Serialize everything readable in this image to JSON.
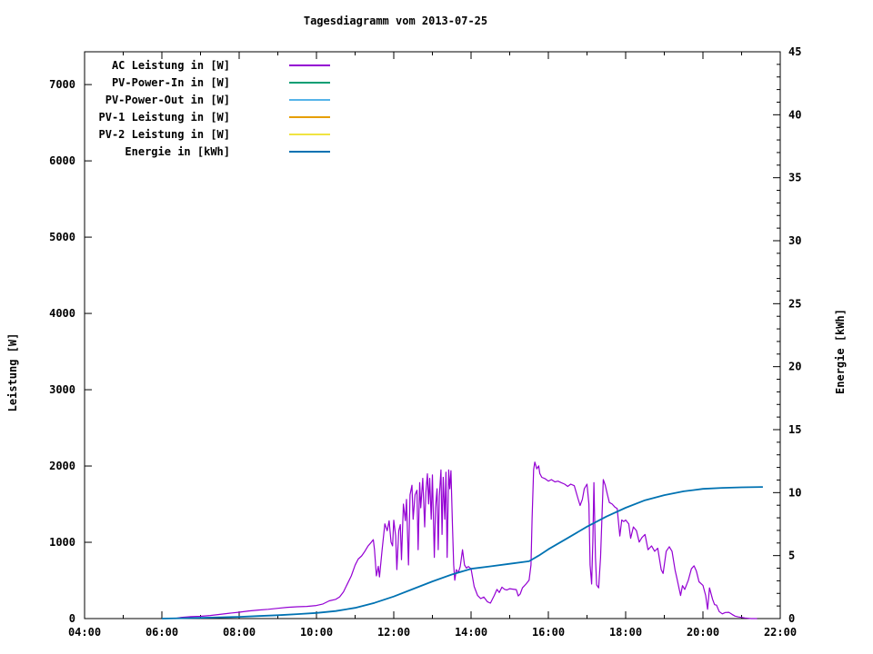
{
  "chart_data": {
    "type": "line",
    "title": "Tagesdiagramm vom 2013-07-25",
    "axes": {
      "x": {
        "tick_labels": [
          "04:00",
          "06:00",
          "08:00",
          "10:00",
          "12:00",
          "14:00",
          "16:00",
          "18:00",
          "20:00",
          "22:00"
        ],
        "tick_hours": [
          4,
          6,
          8,
          10,
          12,
          14,
          16,
          18,
          20,
          22
        ],
        "minor_step_hours": 1,
        "range_hours": [
          4,
          22
        ]
      },
      "y_left": {
        "label": "Leistung [W]",
        "tick_values": [
          0,
          1000,
          2000,
          3000,
          4000,
          5000,
          6000,
          7000
        ],
        "range": [
          0,
          7430
        ]
      },
      "y_right": {
        "label": "Energie [kWh]",
        "tick_values": [
          0,
          5,
          10,
          15,
          20,
          25,
          30,
          35,
          40,
          45
        ],
        "minor_step": 1,
        "range": [
          0,
          45
        ]
      }
    },
    "legend_position": "top-left",
    "grid": false,
    "series": [
      {
        "name": "AC Leistung in [W]",
        "color": "#9400d3",
        "axis": "left",
        "points": [
          [
            6.33,
            0
          ],
          [
            6.5,
            15
          ],
          [
            6.75,
            25
          ],
          [
            7.0,
            30
          ],
          [
            7.25,
            40
          ],
          [
            7.5,
            55
          ],
          [
            7.75,
            70
          ],
          [
            8.0,
            83
          ],
          [
            8.25,
            100
          ],
          [
            8.5,
            112
          ],
          [
            8.75,
            122
          ],
          [
            9.0,
            135
          ],
          [
            9.25,
            148
          ],
          [
            9.5,
            155
          ],
          [
            9.75,
            160
          ],
          [
            10.0,
            172
          ],
          [
            10.17,
            192
          ],
          [
            10.33,
            232
          ],
          [
            10.5,
            252
          ],
          [
            10.6,
            285
          ],
          [
            10.7,
            350
          ],
          [
            10.8,
            455
          ],
          [
            10.9,
            560
          ],
          [
            11.0,
            700
          ],
          [
            11.08,
            780
          ],
          [
            11.17,
            822
          ],
          [
            11.25,
            880
          ],
          [
            11.33,
            948
          ],
          [
            11.42,
            1002
          ],
          [
            11.47,
            1035
          ],
          [
            11.5,
            905
          ],
          [
            11.55,
            560
          ],
          [
            11.6,
            685
          ],
          [
            11.63,
            545
          ],
          [
            11.7,
            902
          ],
          [
            11.77,
            1242
          ],
          [
            11.83,
            1152
          ],
          [
            11.88,
            1282
          ],
          [
            11.93,
            1002
          ],
          [
            11.97,
            952
          ],
          [
            12.0,
            1290
          ],
          [
            12.05,
            1082
          ],
          [
            12.08,
            642
          ],
          [
            12.13,
            1152
          ],
          [
            12.17,
            1232
          ],
          [
            12.2,
            772
          ],
          [
            12.25,
            1500
          ],
          [
            12.3,
            1282
          ],
          [
            12.33,
            1562
          ],
          [
            12.38,
            702
          ],
          [
            12.42,
            1622
          ],
          [
            12.47,
            1748
          ],
          [
            12.5,
            1302
          ],
          [
            12.55,
            1622
          ],
          [
            12.6,
            1682
          ],
          [
            12.63,
            902
          ],
          [
            12.67,
            1782
          ],
          [
            12.7,
            1452
          ],
          [
            12.75,
            1838
          ],
          [
            12.8,
            1202
          ],
          [
            12.83,
            1652
          ],
          [
            12.87,
            1898
          ],
          [
            12.9,
            1502
          ],
          [
            12.93,
            1838
          ],
          [
            12.97,
            1302
          ],
          [
            13.0,
            1882
          ],
          [
            13.05,
            802
          ],
          [
            13.08,
            1452
          ],
          [
            13.12,
            1702
          ],
          [
            13.15,
            902
          ],
          [
            13.18,
            1602
          ],
          [
            13.22,
            1948
          ],
          [
            13.25,
            1102
          ],
          [
            13.28,
            1852
          ],
          [
            13.32,
            1302
          ],
          [
            13.35,
            1918
          ],
          [
            13.38,
            802
          ],
          [
            13.42,
            1948
          ],
          [
            13.45,
            1702
          ],
          [
            13.48,
            1938
          ],
          [
            13.52,
            1202
          ],
          [
            13.55,
            702
          ],
          [
            13.58,
            502
          ],
          [
            13.62,
            642
          ],
          [
            13.67,
            602
          ],
          [
            13.72,
            682
          ],
          [
            13.78,
            902
          ],
          [
            13.83,
            702
          ],
          [
            13.88,
            662
          ],
          [
            13.93,
            682
          ],
          [
            14.0,
            652
          ],
          [
            14.08,
            422
          ],
          [
            14.17,
            302
          ],
          [
            14.25,
            262
          ],
          [
            14.33,
            282
          ],
          [
            14.42,
            222
          ],
          [
            14.5,
            202
          ],
          [
            14.6,
            302
          ],
          [
            14.67,
            382
          ],
          [
            14.73,
            342
          ],
          [
            14.8,
            412
          ],
          [
            14.87,
            382
          ],
          [
            14.93,
            375
          ],
          [
            15.0,
            392
          ],
          [
            15.08,
            386
          ],
          [
            15.17,
            380
          ],
          [
            15.22,
            296
          ],
          [
            15.27,
            322
          ],
          [
            15.33,
            402
          ],
          [
            15.42,
            452
          ],
          [
            15.5,
            502
          ],
          [
            15.55,
            702
          ],
          [
            15.58,
            1302
          ],
          [
            15.62,
            1952
          ],
          [
            15.65,
            2052
          ],
          [
            15.7,
            1962
          ],
          [
            15.75,
            2002
          ],
          [
            15.78,
            1902
          ],
          [
            15.83,
            1852
          ],
          [
            15.92,
            1832
          ],
          [
            16.0,
            1802
          ],
          [
            16.08,
            1822
          ],
          [
            16.17,
            1792
          ],
          [
            16.25,
            1802
          ],
          [
            16.33,
            1782
          ],
          [
            16.42,
            1762
          ],
          [
            16.5,
            1732
          ],
          [
            16.58,
            1762
          ],
          [
            16.67,
            1742
          ],
          [
            16.75,
            1602
          ],
          [
            16.82,
            1482
          ],
          [
            16.88,
            1562
          ],
          [
            16.93,
            1702
          ],
          [
            17.0,
            1762
          ],
          [
            17.05,
            1502
          ],
          [
            17.08,
            702
          ],
          [
            17.12,
            452
          ],
          [
            17.15,
            1002
          ],
          [
            17.18,
            1782
          ],
          [
            17.22,
            802
          ],
          [
            17.25,
            442
          ],
          [
            17.3,
            402
          ],
          [
            17.35,
            802
          ],
          [
            17.42,
            1822
          ],
          [
            17.47,
            1752
          ],
          [
            17.53,
            1622
          ],
          [
            17.58,
            1522
          ],
          [
            17.65,
            1502
          ],
          [
            17.72,
            1462
          ],
          [
            17.78,
            1442
          ],
          [
            17.85,
            1082
          ],
          [
            17.9,
            1292
          ],
          [
            17.95,
            1272
          ],
          [
            18.0,
            1292
          ],
          [
            18.08,
            1242
          ],
          [
            18.13,
            1052
          ],
          [
            18.2,
            1202
          ],
          [
            18.28,
            1152
          ],
          [
            18.35,
            1002
          ],
          [
            18.42,
            1062
          ],
          [
            18.5,
            1102
          ],
          [
            18.58,
            902
          ],
          [
            18.67,
            952
          ],
          [
            18.75,
            882
          ],
          [
            18.83,
            922
          ],
          [
            18.92,
            642
          ],
          [
            18.97,
            592
          ],
          [
            19.05,
            882
          ],
          [
            19.13,
            942
          ],
          [
            19.2,
            882
          ],
          [
            19.28,
            632
          ],
          [
            19.33,
            522
          ],
          [
            19.42,
            302
          ],
          [
            19.47,
            432
          ],
          [
            19.53,
            382
          ],
          [
            19.62,
            502
          ],
          [
            19.7,
            652
          ],
          [
            19.77,
            692
          ],
          [
            19.83,
            622
          ],
          [
            19.9,
            482
          ],
          [
            20.0,
            436
          ],
          [
            20.07,
            302
          ],
          [
            20.12,
            122
          ],
          [
            20.17,
            402
          ],
          [
            20.25,
            252
          ],
          [
            20.3,
            182
          ],
          [
            20.35,
            176
          ],
          [
            20.42,
            92
          ],
          [
            20.5,
            62
          ],
          [
            20.58,
            80
          ],
          [
            20.67,
            82
          ],
          [
            20.75,
            56
          ],
          [
            20.83,
            32
          ],
          [
            20.92,
            22
          ],
          [
            21.0,
            16
          ],
          [
            21.08,
            8
          ],
          [
            21.17,
            4
          ],
          [
            21.25,
            0
          ],
          [
            21.4,
            0
          ]
        ]
      },
      {
        "name": "PV-Power-In in [W]",
        "color": "#009e73",
        "axis": "left",
        "points": []
      },
      {
        "name": "PV-Power-Out in [W]",
        "color": "#56b4e9",
        "axis": "left",
        "points": []
      },
      {
        "name": "PV-1 Leistung in [W]",
        "color": "#e69f00",
        "axis": "left",
        "points": []
      },
      {
        "name": "PV-2 Leistung in [W]",
        "color": "#f0e442",
        "axis": "left",
        "points": []
      },
      {
        "name": "Energie in [kWh]",
        "color": "#0072b2",
        "axis": "right",
        "points": [
          [
            6.0,
            0
          ],
          [
            6.5,
            0.03
          ],
          [
            7.0,
            0.06
          ],
          [
            7.5,
            0.1
          ],
          [
            8.0,
            0.14
          ],
          [
            8.5,
            0.2
          ],
          [
            9.0,
            0.27
          ],
          [
            9.5,
            0.35
          ],
          [
            10.0,
            0.45
          ],
          [
            10.5,
            0.6
          ],
          [
            11.0,
            0.85
          ],
          [
            11.5,
            1.25
          ],
          [
            12.0,
            1.75
          ],
          [
            12.5,
            2.35
          ],
          [
            13.0,
            2.95
          ],
          [
            13.5,
            3.5
          ],
          [
            14.0,
            3.95
          ],
          [
            14.5,
            4.15
          ],
          [
            15.0,
            4.35
          ],
          [
            15.5,
            4.55
          ],
          [
            15.75,
            5.0
          ],
          [
            16.0,
            5.5
          ],
          [
            16.5,
            6.4
          ],
          [
            17.0,
            7.3
          ],
          [
            17.5,
            8.1
          ],
          [
            18.0,
            8.8
          ],
          [
            18.5,
            9.4
          ],
          [
            19.0,
            9.8
          ],
          [
            19.5,
            10.1
          ],
          [
            20.0,
            10.3
          ],
          [
            20.5,
            10.38
          ],
          [
            21.0,
            10.42
          ],
          [
            21.55,
            10.45
          ]
        ]
      }
    ]
  }
}
